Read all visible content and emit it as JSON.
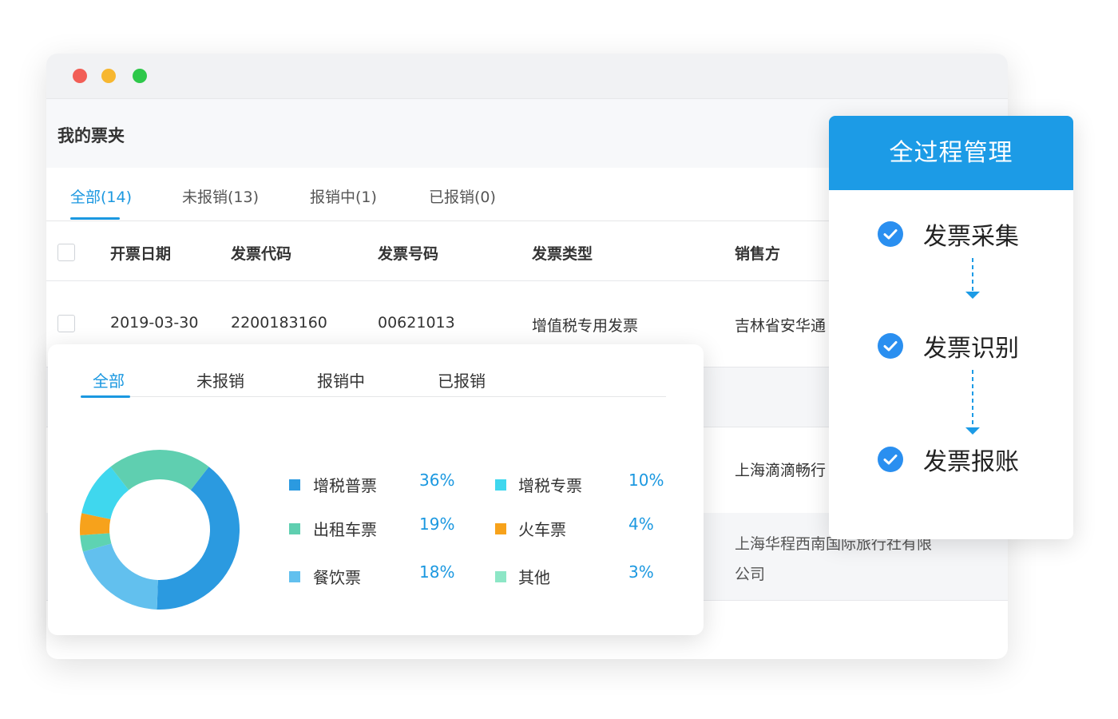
{
  "window": {
    "title": "我的票夹",
    "tabs": [
      {
        "label": "全部(14)",
        "active": true
      },
      {
        "label": "未报销(13)",
        "active": false
      },
      {
        "label": "报销中(1)",
        "active": false
      },
      {
        "label": "已报销(0)",
        "active": false
      }
    ],
    "table": {
      "headers": [
        "开票日期",
        "发票代码",
        "发票号码",
        "发票类型",
        "销售方"
      ],
      "rows": [
        {
          "date": "2019-03-30",
          "code": "2200183160",
          "number": "00621013",
          "type": "增值税专用发票",
          "seller": "吉林省安华通"
        },
        {
          "seller": "上海滴滴畅行"
        },
        {
          "seller_line1": "上海华程西南国际旅行社有限",
          "seller_line2": "公司"
        }
      ]
    }
  },
  "chart_card": {
    "tabs": [
      {
        "label": "全部",
        "active": true
      },
      {
        "label": "未报销",
        "active": false
      },
      {
        "label": "报销中",
        "active": false
      },
      {
        "label": "已报销",
        "active": false
      }
    ]
  },
  "chart_data": {
    "type": "pie",
    "donut": true,
    "title": "",
    "slices": [
      {
        "label": "增税普票",
        "value": 36,
        "pct_label": "36%",
        "color": "#2b9ae0"
      },
      {
        "label": "餐饮票",
        "value": 18,
        "pct_label": "18%",
        "color": "#62c0ee"
      },
      {
        "label": "其他",
        "value": 3,
        "pct_label": "3%",
        "color": "#5ed3b2"
      },
      {
        "label": "火车票",
        "value": 4,
        "pct_label": "4%",
        "color": "#f7a21b"
      },
      {
        "label": "增税专票",
        "value": 10,
        "pct_label": "10%",
        "color": "#3fd7ee"
      },
      {
        "label": "出租车票",
        "value": 19,
        "pct_label": "19%",
        "color": "#5fcfb0"
      }
    ],
    "legend": [
      {
        "label": "增税普票",
        "pct": "36%",
        "color": "#2b9ae0"
      },
      {
        "label": "增税专票",
        "pct": "10%",
        "color": "#3fd7ee"
      },
      {
        "label": "出租车票",
        "pct": "19%",
        "color": "#5fcfb0"
      },
      {
        "label": "火车票",
        "pct": "4%",
        "color": "#f7a21b"
      },
      {
        "label": "餐饮票",
        "pct": "18%",
        "color": "#62c0ee"
      },
      {
        "label": "其他",
        "pct": "3%",
        "color": "#8de6c6"
      }
    ]
  },
  "process": {
    "title": "全过程管理",
    "steps": [
      "发票采集",
      "发票识别",
      "发票报账"
    ],
    "accent": "#1c9be6"
  }
}
